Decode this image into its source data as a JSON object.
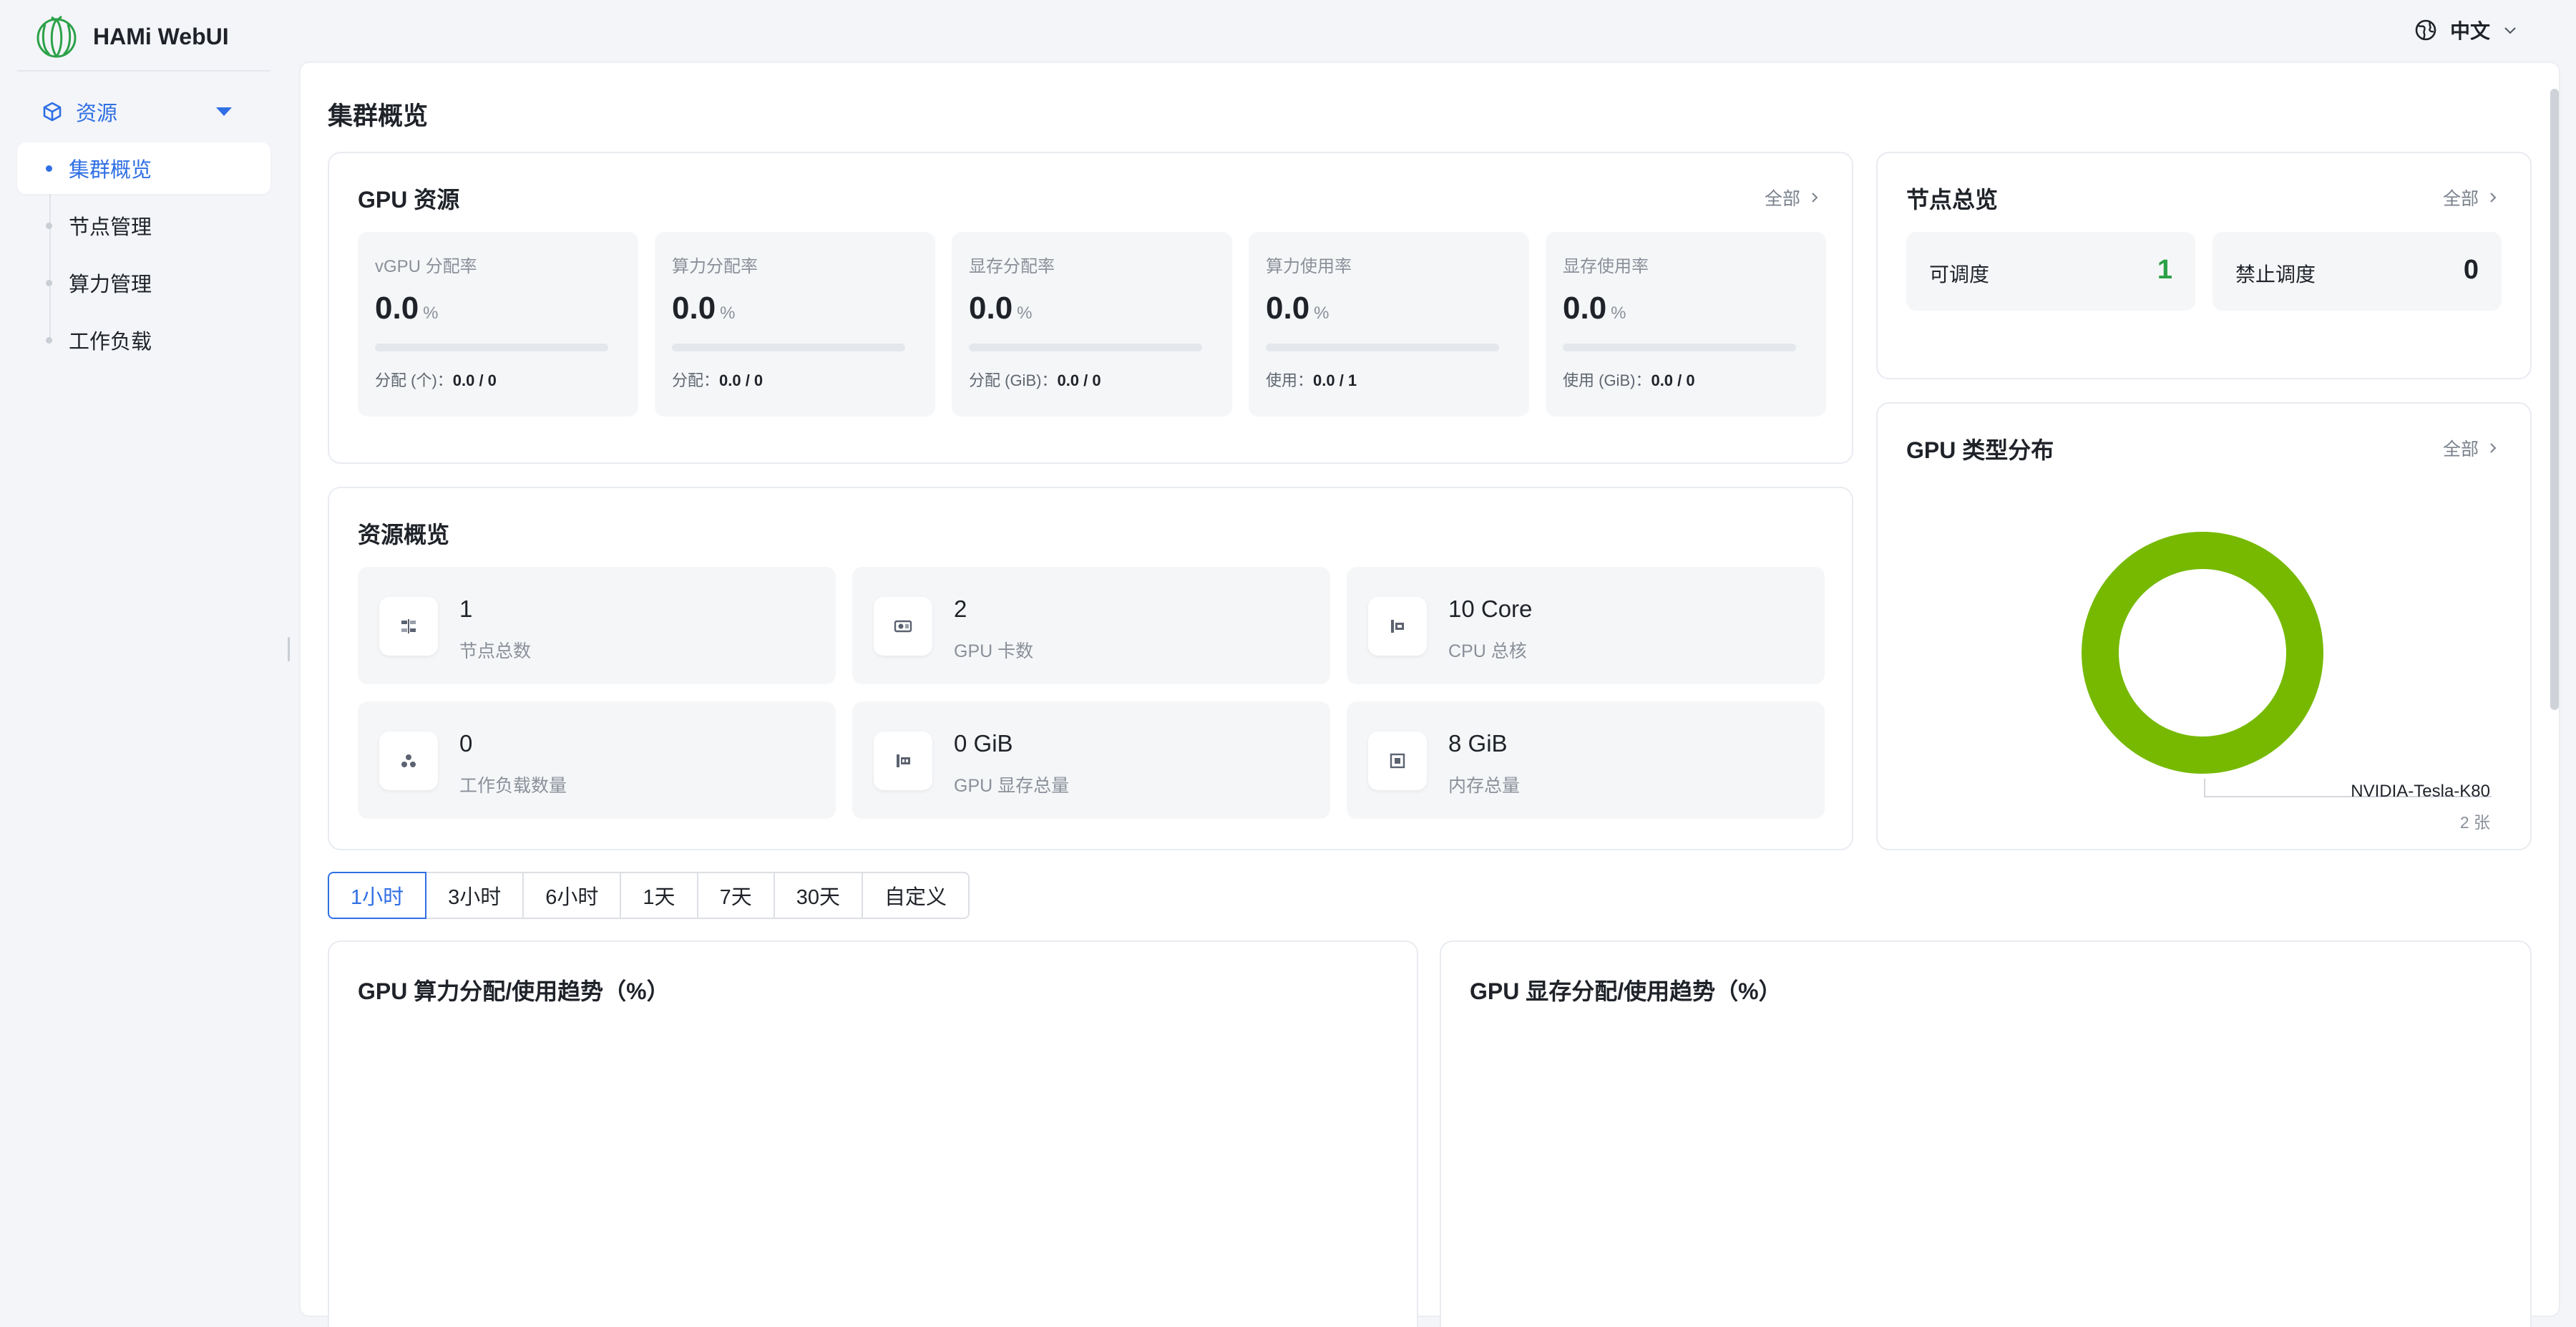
{
  "app": {
    "title": "HAMi WebUI"
  },
  "header": {
    "language": "中文"
  },
  "sidebar": {
    "group": {
      "label": "资源",
      "icon": "cube-icon"
    },
    "items": [
      {
        "label": "集群概览",
        "active": true
      },
      {
        "label": "节点管理",
        "active": false
      },
      {
        "label": "算力管理",
        "active": false
      },
      {
        "label": "工作负载",
        "active": false
      }
    ]
  },
  "page": {
    "title": "集群概览"
  },
  "gpu_resources": {
    "title": "GPU 资源",
    "link": "全部",
    "stats": [
      {
        "label": "vGPU 分配率",
        "value": "0.0",
        "unit": "%",
        "progress": 0,
        "foot_label": "分配 (个)：",
        "foot_value": "0.0 / 0"
      },
      {
        "label": "算力分配率",
        "value": "0.0",
        "unit": "%",
        "progress": 0,
        "foot_label": "分配：",
        "foot_value": "0.0 / 0"
      },
      {
        "label": "显存分配率",
        "value": "0.0",
        "unit": "%",
        "progress": 0,
        "foot_label": "分配 (GiB)：",
        "foot_value": "0.0 / 0"
      },
      {
        "label": "算力使用率",
        "value": "0.0",
        "unit": "%",
        "progress": 0,
        "foot_label": "使用：",
        "foot_value": "0.0 / 1"
      },
      {
        "label": "显存使用率",
        "value": "0.0",
        "unit": "%",
        "progress": 0,
        "foot_label": "使用 (GiB)：",
        "foot_value": "0.0 / 0"
      }
    ]
  },
  "node_overview": {
    "title": "节点总览",
    "link": "全部",
    "schedulable": {
      "label": "可调度",
      "value": "1",
      "color": "#2ca148"
    },
    "unschedulable": {
      "label": "禁止调度",
      "value": "0",
      "color": "#1f2329"
    }
  },
  "resource_overview": {
    "title": "资源概览",
    "items": [
      {
        "value": "1",
        "label": "节点总数",
        "icon": "nodes-icon"
      },
      {
        "value": "2",
        "label": "GPU 卡数",
        "icon": "gpu-card-icon"
      },
      {
        "value": "10 Core",
        "label": "CPU 总核",
        "icon": "cpu-icon"
      },
      {
        "value": "0",
        "label": "工作负载数量",
        "icon": "workload-icon"
      },
      {
        "value": "0 GiB",
        "label": "GPU 显存总量",
        "icon": "gpu-memory-icon"
      },
      {
        "value": "8 GiB",
        "label": "内存总量",
        "icon": "memory-icon"
      }
    ]
  },
  "gpu_types": {
    "title": "GPU 类型分布",
    "link": "全部",
    "slices": [
      {
        "name": "NVIDIA-Tesla-K80",
        "count": "2 张",
        "value": 2,
        "color": "#76b900"
      }
    ]
  },
  "time_range": {
    "options": [
      "1小时",
      "3小时",
      "6小时",
      "1天",
      "7天",
      "30天",
      "自定义"
    ],
    "selected": "1小时"
  },
  "charts": {
    "compute_trend": {
      "title": "GPU 算力分配/使用趋势（%）"
    },
    "memory_trend": {
      "title": "GPU 显存分配/使用趋势（%）"
    }
  },
  "colors": {
    "accent": "#2f6fe4",
    "success": "#2ca148",
    "nvidia_green": "#76b900"
  }
}
